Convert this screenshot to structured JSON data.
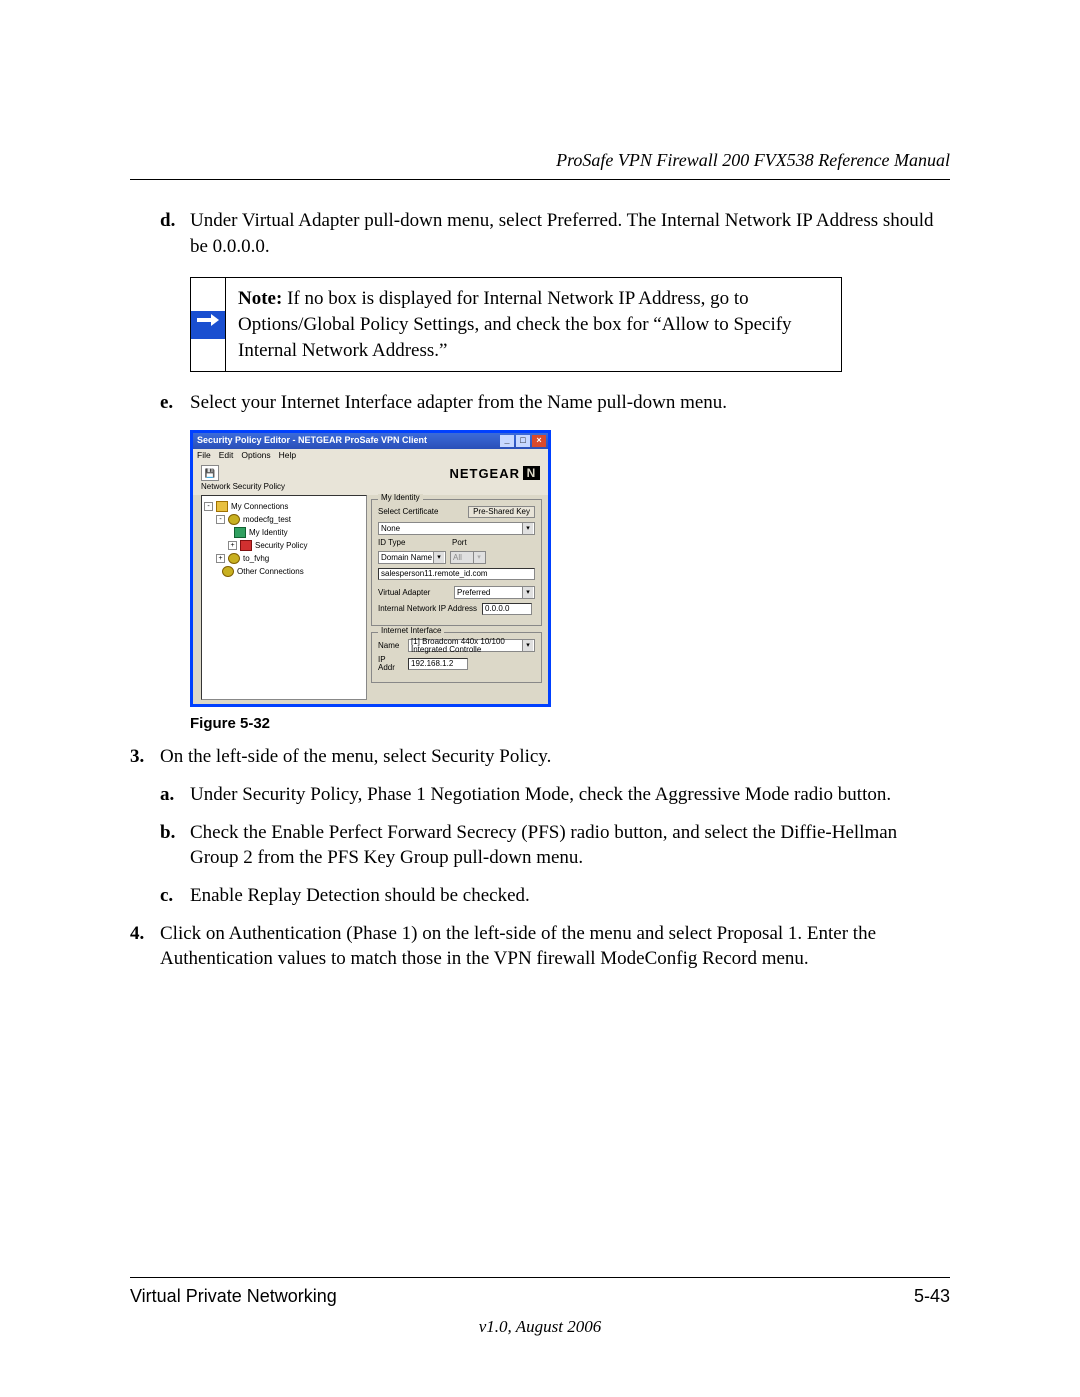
{
  "header": {
    "manual_title": "ProSafe VPN Firewall 200 FVX538 Reference Manual"
  },
  "content": {
    "item_d": {
      "marker": "d.",
      "text": "Under Virtual Adapter pull-down menu, select Preferred. The Internal Network IP Address should be 0.0.0.0."
    },
    "note": {
      "label": "Note:",
      "text": " If no box is displayed for Internal Network IP Address, go to Options/Global Policy Settings, and check the box for “Allow to Specify Internal Network Address.”"
    },
    "item_e": {
      "marker": "e.",
      "text": "Select your Internet Interface adapter from the Name pull-down menu."
    },
    "figure_caption": "Figure 5-32",
    "item_3": {
      "marker": "3.",
      "text": "On the left-side of the menu, select Security Policy."
    },
    "item_3a": {
      "marker": "a.",
      "text": "Under Security Policy, Phase 1 Negotiation Mode, check the Aggressive Mode radio button."
    },
    "item_3b": {
      "marker": "b.",
      "text": "Check the Enable Perfect Forward Secrecy (PFS) radio button, and select the Diffie-Hellman Group 2 from the PFS Key Group pull-down menu."
    },
    "item_3c": {
      "marker": "c.",
      "text": "Enable Replay Detection should be checked."
    },
    "item_4": {
      "marker": "4.",
      "text": "Click on Authentication (Phase 1) on the left-side of the menu and select Proposal 1. Enter the Authentication values to match those in the VPN firewall ModeConfig Record menu."
    }
  },
  "screenshot": {
    "title": "Security Policy Editor - NETGEAR ProSafe VPN Client",
    "menus": [
      "File",
      "Edit",
      "Options",
      "Help"
    ],
    "brand": "NETGEAR",
    "policy_label": "Network Security Policy",
    "tree": {
      "root": "My Connections",
      "conn1": "modecfg_test",
      "identity": "My Identity",
      "security": "Security Policy",
      "conn2": "to_fvhg",
      "other": "Other Connections"
    },
    "identity": {
      "fieldset_label": "My Identity",
      "select_cert": "Select Certificate",
      "pre_shared_btn": "Pre-Shared Key",
      "cert_value": "None",
      "id_type_label": "ID Type",
      "port_label": "Port",
      "id_type_value": "Domain Name",
      "port_value": "All",
      "domain_value": "salesperson11.remote_id.com",
      "virtual_adapter_label": "Virtual Adapter",
      "virtual_adapter_value": "Preferred",
      "internal_ip_label": "Internal Network IP Address",
      "internal_ip_value": "0.0.0.0"
    },
    "interface": {
      "fieldset_label": "Internet Interface",
      "name_label": "Name",
      "name_value": "[1] Broadcom 440x 10/100 Integrated Controlle",
      "ip_addr_label": "IP Addr",
      "ip_addr_value": "192.168.1.2"
    }
  },
  "footer": {
    "section": "Virtual Private Networking",
    "page_number": "5-43",
    "version": "v1.0, August 2006"
  }
}
